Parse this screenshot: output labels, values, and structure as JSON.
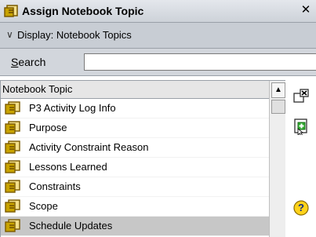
{
  "window": {
    "title": "Assign Notebook Topic",
    "close_glyph": "✕"
  },
  "display": {
    "chevron": "∨",
    "label": "Display: Notebook Topics"
  },
  "search": {
    "label_access": "S",
    "label_rest": "earch",
    "value": ""
  },
  "list": {
    "column_header": "Notebook Topic",
    "items": [
      {
        "label": "P3 Activity Log Info",
        "selected": false
      },
      {
        "label": "Purpose",
        "selected": false
      },
      {
        "label": "Activity Constraint Reason",
        "selected": false
      },
      {
        "label": "Lessons Learned",
        "selected": false
      },
      {
        "label": "Constraints",
        "selected": false
      },
      {
        "label": "Scope",
        "selected": false
      },
      {
        "label": "Schedule Updates",
        "selected": true
      }
    ]
  },
  "tools": {
    "remove": "remove-topic-icon",
    "assign": "assign-topic-icon",
    "help": "help-icon"
  },
  "colors": {
    "selected_row": "#c7c7c7",
    "notebook_icon": "#c8a300",
    "help_icon": "#ffd21a"
  }
}
